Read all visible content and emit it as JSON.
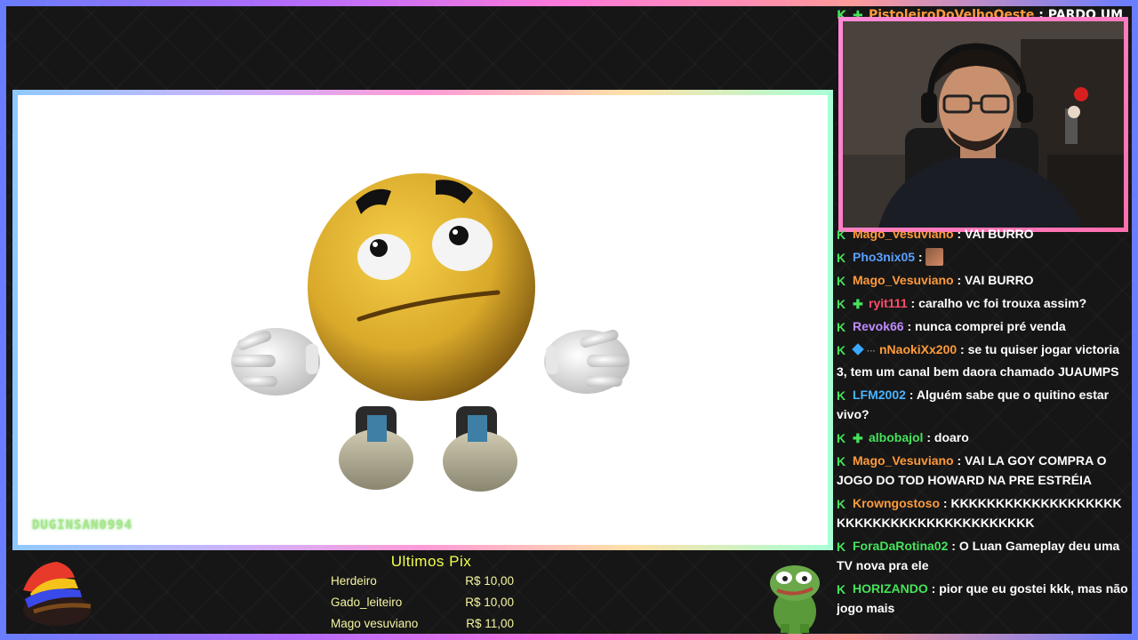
{
  "stream": {
    "watermark": "DUGINSAN0994"
  },
  "chat": {
    "partial_top": {
      "user": "PistoleiroDoVelhoOeste",
      "text": "PARDO UM DIA"
    },
    "messages": [
      {
        "user": "Mago_Vesuviano",
        "color": "#ff9a3c",
        "text": "VAI BURRO",
        "badges": [
          "check"
        ]
      },
      {
        "user": "Pho3nix05",
        "color": "#5aa0ff",
        "text": "",
        "badges": [
          "check"
        ],
        "emote": true
      },
      {
        "user": "Mago_Vesuviano",
        "color": "#ff9a3c",
        "text": "VAI BURRO",
        "badges": [
          "check"
        ]
      },
      {
        "user": "ryit111",
        "color": "#ff4d6a",
        "text": "caralho vc foi trouxa assim?",
        "badges": [
          "check",
          "plus"
        ]
      },
      {
        "user": "Revok66",
        "color": "#c08cff",
        "text": "nunca comprei pré venda",
        "badges": [
          "check"
        ]
      },
      {
        "user": "nNaokiXx200",
        "color": "#ff9a3c",
        "text": "se tu quiser jogar victoria 3, tem um canal bem daora chamado JUAUMPS",
        "badges": [
          "check",
          "cube",
          "dots"
        ]
      },
      {
        "user": "LFM2002",
        "color": "#4ab3ff",
        "text": "Alguém sabe que o quitino estar vivo?",
        "badges": [
          "check"
        ]
      },
      {
        "user": "albobajol",
        "color": "#45e35a",
        "text": "doaro",
        "badges": [
          "check",
          "plus"
        ]
      },
      {
        "user": "Mago_Vesuviano",
        "color": "#ff9a3c",
        "text": "VAI LA GOY COMPRA O JOGO DO TOD HOWARD NA PRE ESTRÉIA",
        "badges": [
          "check"
        ]
      },
      {
        "user": "Krowngostoso",
        "color": "#ff9a3c",
        "text": "KKKKKKKKKKKKKKKKKKKKKKKKKKKKKKKKKKKKKKKKK",
        "badges": [
          "check"
        ]
      },
      {
        "user": "ForaDaRotina02",
        "color": "#45e35a",
        "text": "O Luan Gameplay deu uma TV nova pra ele",
        "badges": [
          "check"
        ]
      },
      {
        "user": "HORIZANDO",
        "color": "#45e35a",
        "text": "pior que eu gostei kkk, mas não jogo mais",
        "badges": [
          "check"
        ]
      }
    ]
  },
  "pix": {
    "title": "Ultimos Pix",
    "rows": [
      {
        "name": "Herdeiro",
        "amount": "R$ 10,00"
      },
      {
        "name": "Gado_leiteiro",
        "amount": "R$ 10,00"
      },
      {
        "name": "Mago vesuviano",
        "amount": "R$ 11,00"
      }
    ]
  },
  "icons": {
    "badge_check": "K",
    "badge_plus": "✚",
    "frame_colors": [
      "#6a7cff",
      "#b36cff",
      "#ff7ad9",
      "#ff9a9a"
    ]
  }
}
